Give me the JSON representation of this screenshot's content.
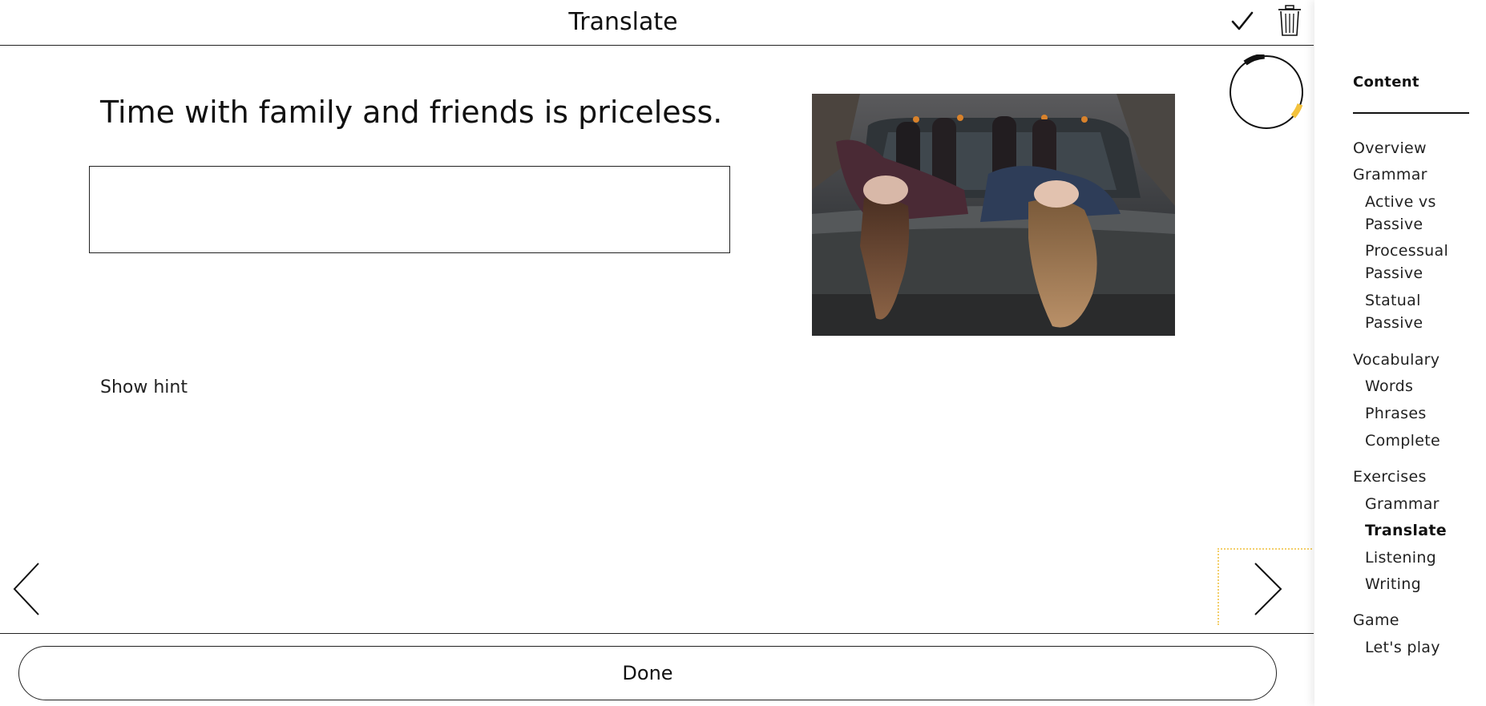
{
  "header": {
    "title": "Translate"
  },
  "exercise": {
    "sentence": "Time with family and friends is priceless.",
    "answer_value": "",
    "answer_placeholder": "",
    "show_hint_label": "Show hint"
  },
  "progress": {
    "fraction_done": 0.1,
    "accent_color": "#f3c23c"
  },
  "footer": {
    "done_label": "Done"
  },
  "sidebar": {
    "title": "Content",
    "items": [
      {
        "label": "Overview",
        "level": 0
      },
      {
        "label": "Grammar",
        "level": 0
      },
      {
        "label": "Active vs",
        "level": 1
      },
      {
        "label": "Passive",
        "level": 1
      },
      {
        "label": "Processual",
        "level": 1
      },
      {
        "label": "Passive",
        "level": 1
      },
      {
        "label": "Statual",
        "level": 1
      },
      {
        "label": "Passive",
        "level": 1
      },
      {
        "label": "Vocabulary",
        "level": 0
      },
      {
        "label": "Words",
        "level": 1
      },
      {
        "label": "Phrases",
        "level": 1
      },
      {
        "label": "Complete",
        "level": 1
      },
      {
        "label": "Exercises",
        "level": 0
      },
      {
        "label": "Grammar",
        "level": 1
      },
      {
        "label": "Translate",
        "level": 1,
        "active": true
      },
      {
        "label": "Listening",
        "level": 1
      },
      {
        "label": "Writing",
        "level": 1
      },
      {
        "label": "Game",
        "level": 0
      },
      {
        "label": "Let's play",
        "level": 1
      }
    ]
  },
  "icons": {
    "confirm": "check-icon",
    "delete": "trash-icon",
    "previous": "chevron-left-icon",
    "next": "chevron-right-icon"
  }
}
